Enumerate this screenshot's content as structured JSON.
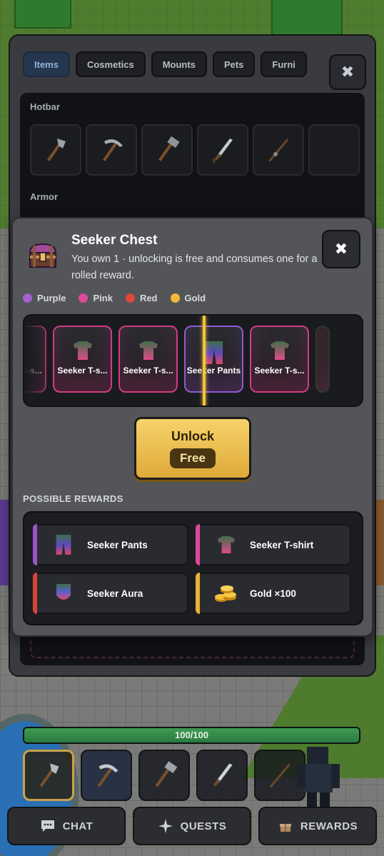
{
  "inventory": {
    "tabs": [
      {
        "label": "Items",
        "active": true
      },
      {
        "label": "Cosmetics",
        "active": false
      },
      {
        "label": "Mounts",
        "active": false
      },
      {
        "label": "Pets",
        "active": false
      },
      {
        "label": "Furni",
        "active": false
      }
    ],
    "close_label": "✖",
    "hotbar_label": "Hotbar",
    "armor_label": "Armor",
    "hotbar_slots": [
      "axe",
      "pickaxe",
      "hammer",
      "sword",
      "fishing-rod",
      "empty"
    ]
  },
  "chest": {
    "title": "Seeker Chest",
    "subtitle": "You own 1 · unlocking is free and consumes one for a rolled reward.",
    "close_label": "✖",
    "rarity_legend": [
      {
        "label": "Purple",
        "color": "#a45fd0"
      },
      {
        "label": "Pink",
        "color": "#e0489a"
      },
      {
        "label": "Red",
        "color": "#e0453a"
      },
      {
        "label": "Gold",
        "color": "#f0b93a"
      }
    ],
    "reel": [
      {
        "name": "Seeker T-s...",
        "rarity": "pink"
      },
      {
        "name": "Seeker T-s...",
        "rarity": "pink"
      },
      {
        "name": "Seeker T-s...",
        "rarity": "pink"
      },
      {
        "name": "Seeker Pants",
        "rarity": "purple"
      },
      {
        "name": "Seeker T-s...",
        "rarity": "pink"
      }
    ],
    "unlock": {
      "label": "Unlock",
      "price": "Free"
    },
    "possible_rewards_label": "POSSIBLE REWARDS",
    "rewards": [
      {
        "name": "Seeker Pants",
        "color": "#9a55c8"
      },
      {
        "name": "Seeker T-shirt",
        "color": "#e0489a"
      },
      {
        "name": "Seeker Aura",
        "color": "#d8443a"
      },
      {
        "name": "Gold ×100",
        "color": "#e7b33a"
      }
    ]
  },
  "hud": {
    "health_text": "100/100",
    "health_fraction": 1.0,
    "hotbar": [
      "axe",
      "pickaxe",
      "hammer",
      "sword",
      "fishing-rod"
    ],
    "buttons": [
      {
        "label": "CHAT",
        "icon": "chat-icon"
      },
      {
        "label": "QUESTS",
        "icon": "sparkle-icon"
      },
      {
        "label": "REWARDS",
        "icon": "gift-icon"
      }
    ]
  }
}
